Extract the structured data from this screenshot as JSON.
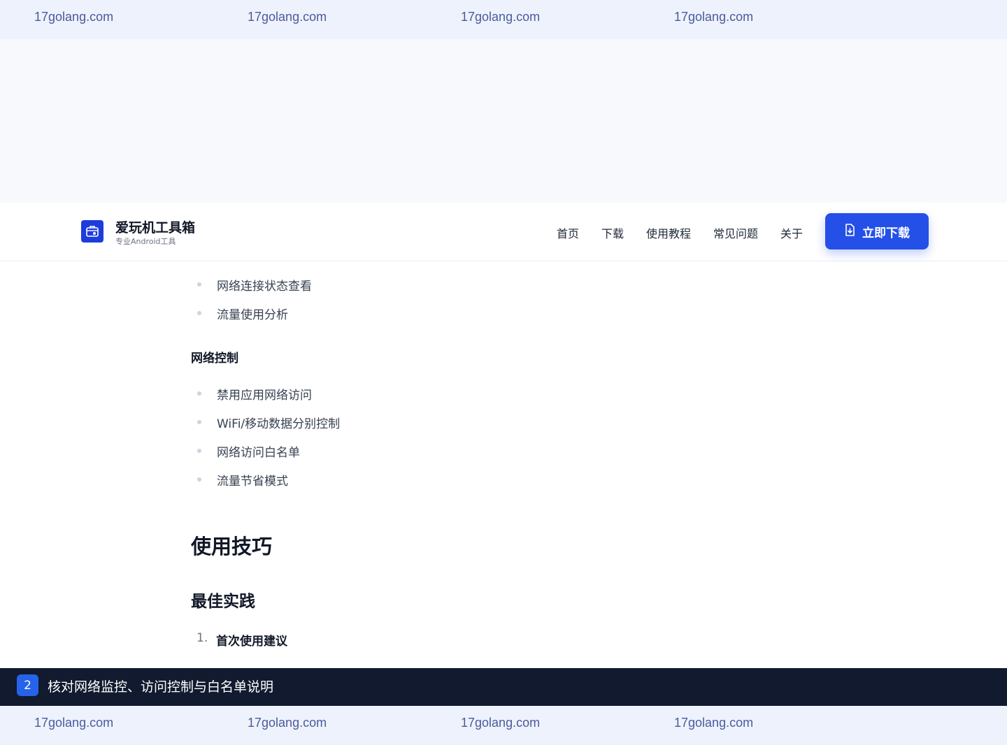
{
  "watermark": {
    "text": "17golang.com"
  },
  "header": {
    "brand_title": "爱玩机工具箱",
    "brand_subtitle": "专业Android工具",
    "logo_icon": "toolbox-icon",
    "nav": [
      "首页",
      "下载",
      "使用教程",
      "常见问题",
      "关于"
    ],
    "download_button": "立即下载",
    "download_icon": "file-download-icon",
    "accent_color": "#2450e8"
  },
  "content": {
    "monitor_items": [
      "网络连接状态查看",
      "流量使用分析"
    ],
    "network_control_heading": "网络控制",
    "network_control_items": [
      "禁用应用网络访问",
      "WiFi/移动数据分别控制",
      "网络访问白名单",
      "流量节省模式"
    ],
    "tips_heading": "使用技巧",
    "best_practice_heading": "最佳实践",
    "ordered_item_number": "1.",
    "ordered_item_text": "首次使用建议"
  },
  "caption": {
    "step": "2",
    "text": "核对网络监控、访问控制与白名单说明"
  }
}
